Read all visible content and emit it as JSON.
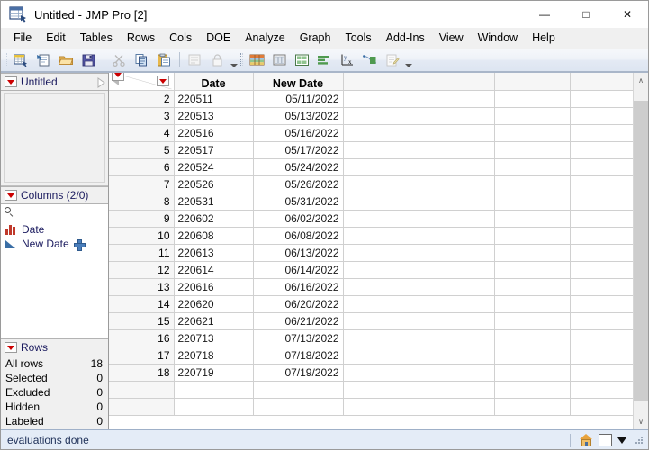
{
  "window": {
    "title": "Untitled - JMP Pro [2]",
    "app_icon": "jmp-table-icon",
    "controls": [
      {
        "name": "minimize",
        "glyph": "—"
      },
      {
        "name": "maximize",
        "glyph": "□"
      },
      {
        "name": "close",
        "glyph": "✕"
      }
    ]
  },
  "menubar": {
    "items": [
      "File",
      "Edit",
      "Tables",
      "Rows",
      "Cols",
      "DOE",
      "Analyze",
      "Graph",
      "Tools",
      "Add-Ins",
      "View",
      "Window",
      "Help"
    ]
  },
  "toolbar": {
    "group1": [
      "new-data-table-icon",
      "new-script-icon",
      "open-folder-icon",
      "save-icon"
    ],
    "group2": [
      "cut-scissors-icon",
      "copy-icon",
      "paste-icon"
    ],
    "group3": [
      "properties-icon",
      "lock-icon"
    ],
    "group4": [
      "distribution-icon",
      "fit-y-by-x-icon",
      "tabulate-icon",
      "bar-chart-icon",
      "fit-model-icon",
      "graph-builder-icon",
      "script-editor-icon"
    ],
    "overflow_glyph": "▼"
  },
  "left_panel": {
    "table_panel": {
      "title": "Untitled",
      "menu_icon": "red-triangle-menu-icon",
      "expand_icon": "expand-arrow-icon"
    },
    "columns_panel": {
      "title": "Columns (2/0)",
      "menu_icon": "red-triangle-menu-icon",
      "search_placeholder": "",
      "search_icon": "search-icon",
      "items": [
        {
          "label": "Date",
          "type_icon": "nominal-bars-icon",
          "has_formula": false
        },
        {
          "label": "New Date",
          "type_icon": "continuous-triangle-icon",
          "has_formula": true,
          "formula_icon": "plus-formula-icon"
        }
      ]
    },
    "rows_panel": {
      "title": "Rows",
      "menu_icon": "red-triangle-menu-icon",
      "stats": [
        {
          "label": "All rows",
          "value": "18"
        },
        {
          "label": "Selected",
          "value": "0"
        },
        {
          "label": "Excluded",
          "value": "0"
        },
        {
          "label": "Hidden",
          "value": "0"
        },
        {
          "label": "Labeled",
          "value": "0"
        }
      ]
    }
  },
  "grid": {
    "corner": {
      "collapse_icon": "collapse-left-triangle-icon",
      "rows_menu_icon": "red-triangle-menu-icon",
      "cols_menu_icon": "red-triangle-menu-icon",
      "sort_bars_icon": "sort-bars-icon"
    },
    "columns": [
      {
        "label": "Date",
        "align": "left"
      },
      {
        "label": "New Date",
        "align": "right"
      },
      {
        "label": "",
        "align": "left"
      },
      {
        "label": "",
        "align": "left"
      },
      {
        "label": "",
        "align": "left"
      },
      {
        "label": "",
        "align": "left"
      }
    ],
    "rows": [
      {
        "num": "2",
        "cells": [
          "220511",
          "05/11/2022",
          "",
          "",
          "",
          ""
        ]
      },
      {
        "num": "3",
        "cells": [
          "220513",
          "05/13/2022",
          "",
          "",
          "",
          ""
        ]
      },
      {
        "num": "4",
        "cells": [
          "220516",
          "05/16/2022",
          "",
          "",
          "",
          ""
        ]
      },
      {
        "num": "5",
        "cells": [
          "220517",
          "05/17/2022",
          "",
          "",
          "",
          ""
        ]
      },
      {
        "num": "6",
        "cells": [
          "220524",
          "05/24/2022",
          "",
          "",
          "",
          ""
        ]
      },
      {
        "num": "7",
        "cells": [
          "220526",
          "05/26/2022",
          "",
          "",
          "",
          ""
        ]
      },
      {
        "num": "8",
        "cells": [
          "220531",
          "05/31/2022",
          "",
          "",
          "",
          ""
        ]
      },
      {
        "num": "9",
        "cells": [
          "220602",
          "06/02/2022",
          "",
          "",
          "",
          ""
        ]
      },
      {
        "num": "10",
        "cells": [
          "220608",
          "06/08/2022",
          "",
          "",
          "",
          ""
        ]
      },
      {
        "num": "11",
        "cells": [
          "220613",
          "06/13/2022",
          "",
          "",
          "",
          ""
        ]
      },
      {
        "num": "12",
        "cells": [
          "220614",
          "06/14/2022",
          "",
          "",
          "",
          ""
        ]
      },
      {
        "num": "13",
        "cells": [
          "220616",
          "06/16/2022",
          "",
          "",
          "",
          ""
        ]
      },
      {
        "num": "14",
        "cells": [
          "220620",
          "06/20/2022",
          "",
          "",
          "",
          ""
        ]
      },
      {
        "num": "15",
        "cells": [
          "220621",
          "06/21/2022",
          "",
          "",
          "",
          ""
        ]
      },
      {
        "num": "16",
        "cells": [
          "220713",
          "07/13/2022",
          "",
          "",
          "",
          ""
        ]
      },
      {
        "num": "17",
        "cells": [
          "220718",
          "07/18/2022",
          "",
          "",
          "",
          ""
        ]
      },
      {
        "num": "18",
        "cells": [
          "220719",
          "07/19/2022",
          "",
          "",
          "",
          ""
        ]
      },
      {
        "num": "",
        "cells": [
          "",
          "",
          "",
          "",
          "",
          ""
        ]
      },
      {
        "num": "",
        "cells": [
          "",
          "",
          "",
          "",
          "",
          ""
        ]
      }
    ],
    "scrollbar": {
      "up_glyph": "∧",
      "down_glyph": "∨"
    }
  },
  "statusbar": {
    "message": "evaluations done",
    "home_icon": "home-house-icon",
    "window_icon": "window-square-icon",
    "dropdown_icon": "dropdown-triangle-icon",
    "resize_icon": "resize-grip-icon"
  },
  "colors": {
    "titlebar_bg": "#ffffff",
    "menubar_bg": "#f0f0f0",
    "toolbar_bg": "#e8eef7",
    "panel_bg": "#f0f0f0",
    "panel_title_text": "#1a1a5e",
    "grid_header_bg": "#f6f6f6",
    "statusbar_bg": "#e4ecf7",
    "red_triangle": "#cc0000",
    "nominal_icon": "#c0392b",
    "continuous_icon": "#3a6ea5"
  }
}
